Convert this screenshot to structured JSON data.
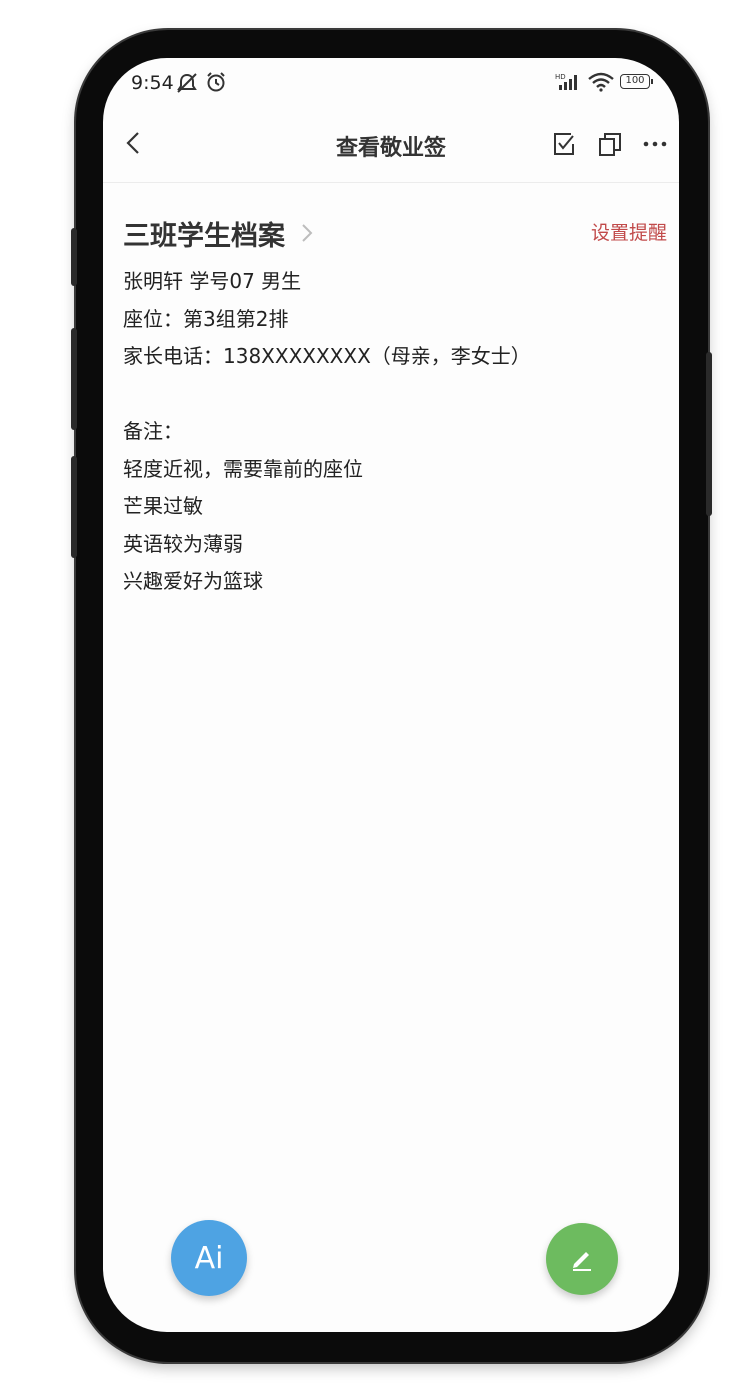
{
  "status_bar": {
    "time": "9:54",
    "battery": "100",
    "network_label": "HD"
  },
  "header": {
    "title": "查看敬业签"
  },
  "note": {
    "title": "三班学生档案",
    "reminder_label": "设置提醒",
    "lines": [
      "张明轩 学号07 男生",
      "座位：第3组第2排",
      "家长电话：138XXXXXXXX（母亲，李女士）",
      "",
      "备注：",
      "轻度近视，需要靠前的座位",
      "芒果过敏",
      "英语较为薄弱",
      "兴趣爱好为篮球"
    ]
  },
  "fab": {
    "ai_label": "Ai"
  },
  "icons": {
    "back": "back-arrow-icon",
    "check": "checkbox-icon",
    "copy": "copy-icon",
    "more": "more-icon",
    "edit": "pencil-icon",
    "chevron": "chevron-right-icon"
  },
  "colors": {
    "reminder": "#c14a4a",
    "ai_fab": "#4ea3e3",
    "edit_fab": "#6dbb5f"
  }
}
